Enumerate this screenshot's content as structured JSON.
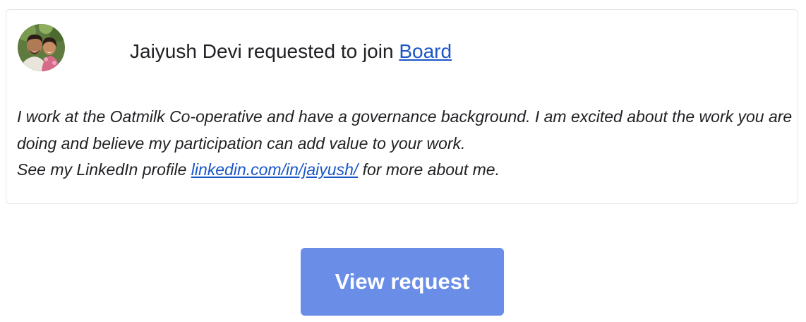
{
  "request": {
    "requester_name": "Jaiyush Devi",
    "action_text": "requested to join",
    "group_link": "Board",
    "avatar_icon": "user-photo-avatar"
  },
  "message": {
    "paragraph": "I work at the Oatmilk Co-operative and have a governance background. I am excited about the work you are doing and believe my participation can add value to your work.",
    "linkedin_prefix": "See my LinkedIn profile",
    "linkedin_link": "linkedin.com/in/jaiyush/",
    "linkedin_suffix": "for more about me."
  },
  "actions": {
    "view_request_label": "View request"
  },
  "colors": {
    "link": "#1a56c8",
    "button_bg": "#6a8ee8",
    "button_text": "#ffffff",
    "card_border": "#e6e6e6"
  }
}
